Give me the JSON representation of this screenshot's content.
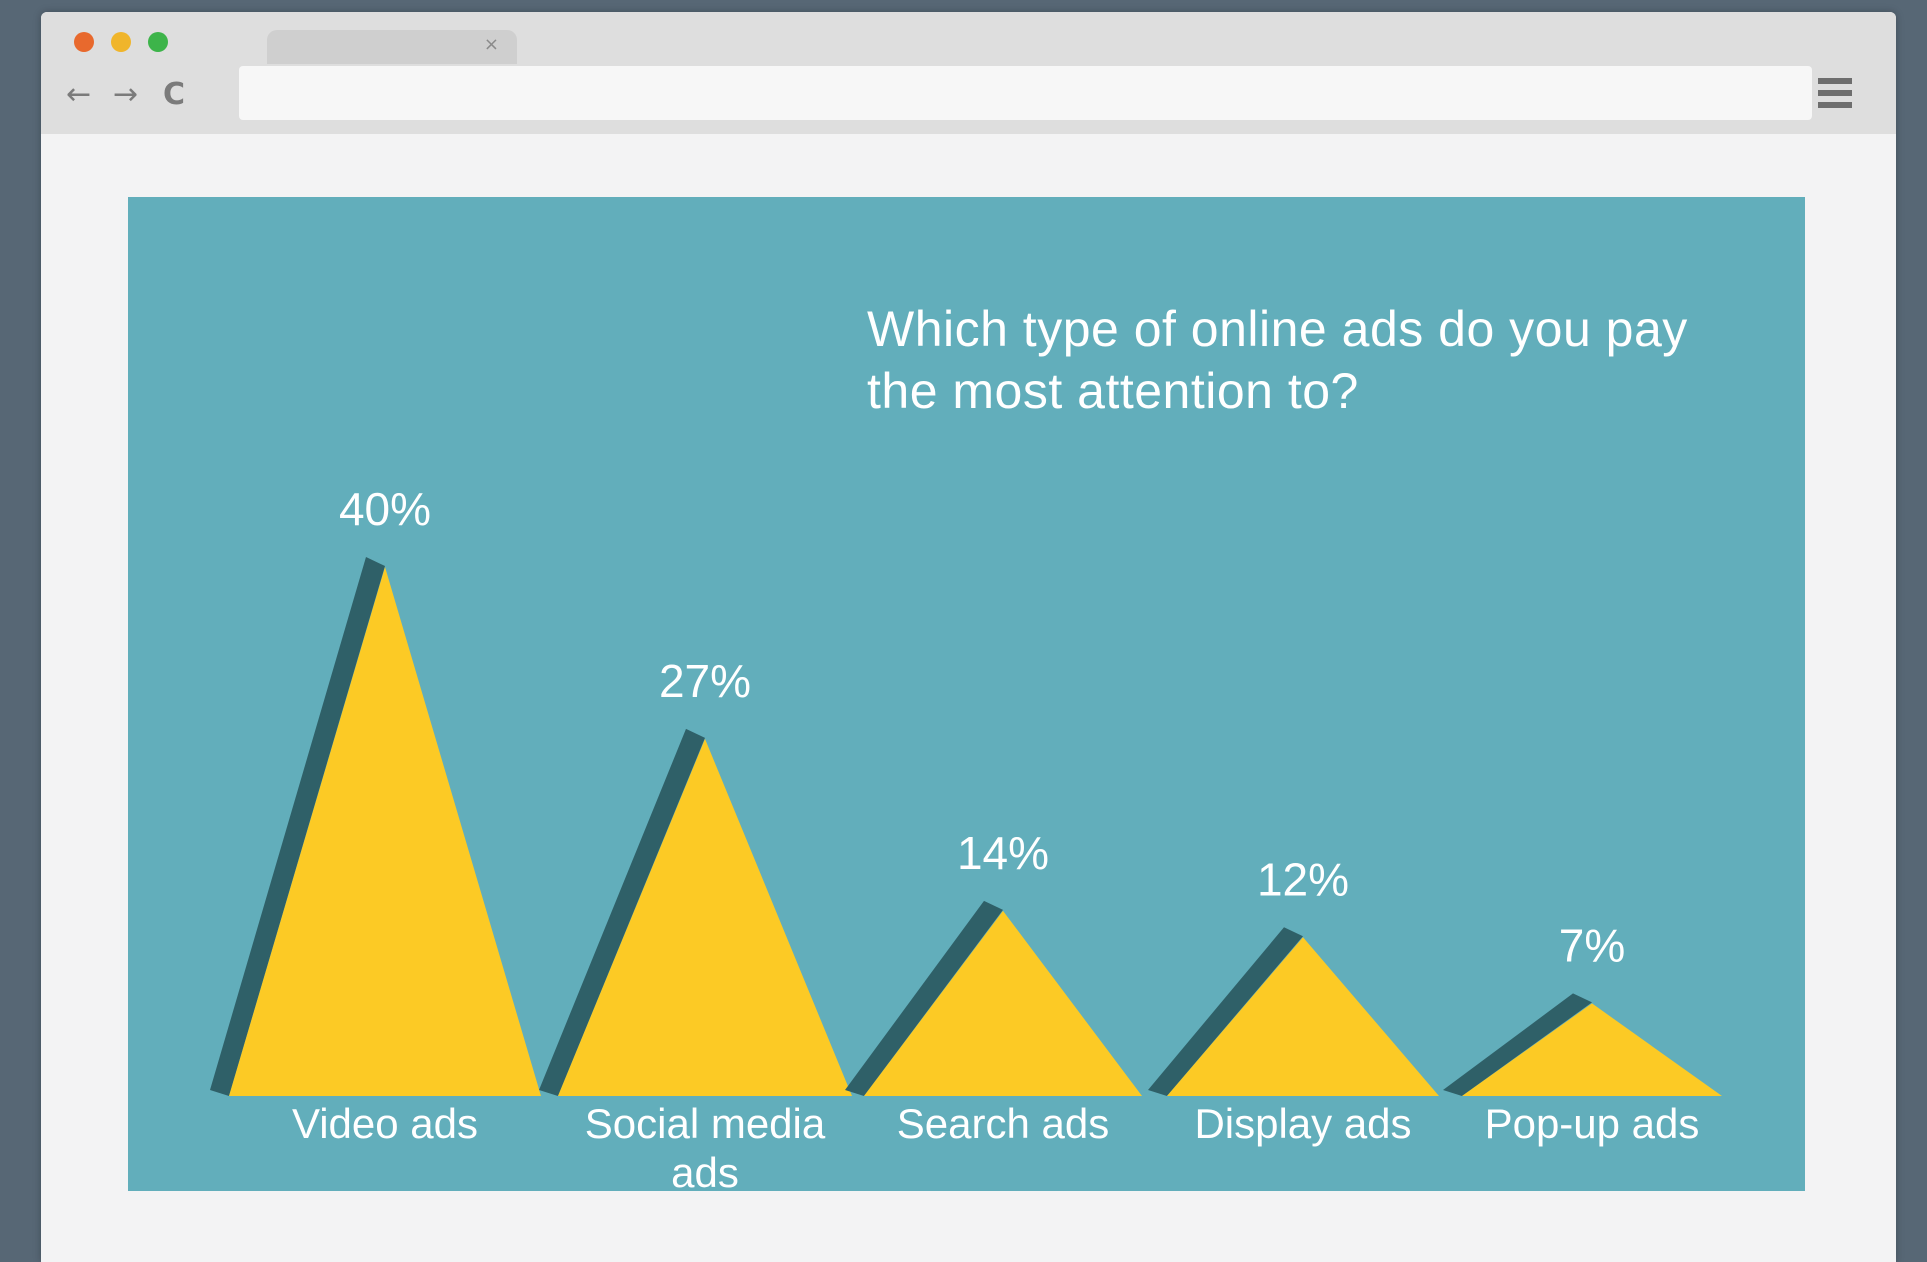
{
  "browser": {
    "tab_close": "×",
    "nav": {
      "back": "←",
      "forward": "→",
      "reload": "C"
    },
    "icons": [
      "back-arrow-icon",
      "forward-arrow-icon",
      "reload-icon",
      "close-icon",
      "hamburger-menu-icon"
    ],
    "colors": {
      "close": "#e8692d",
      "minimize": "#f0b52b",
      "maximize": "#3db44a"
    }
  },
  "chart_data": {
    "type": "bar",
    "title": "Which type of online ads do you pay the most attention to?",
    "categories": [
      "Video ads",
      "Social media ads",
      "Search ads",
      "Display ads",
      "Pop-up ads"
    ],
    "values": [
      40,
      27,
      14,
      12,
      7
    ],
    "value_labels": [
      "40%",
      "27%",
      "14%",
      "12%",
      "7%"
    ],
    "unit": "%",
    "ylim": [
      0,
      40
    ],
    "grid": false,
    "legend": "none",
    "colors": {
      "background": "#62aebb",
      "mark": "#fcca25",
      "shadow": "#2f6068",
      "text": "#ffffff"
    }
  }
}
